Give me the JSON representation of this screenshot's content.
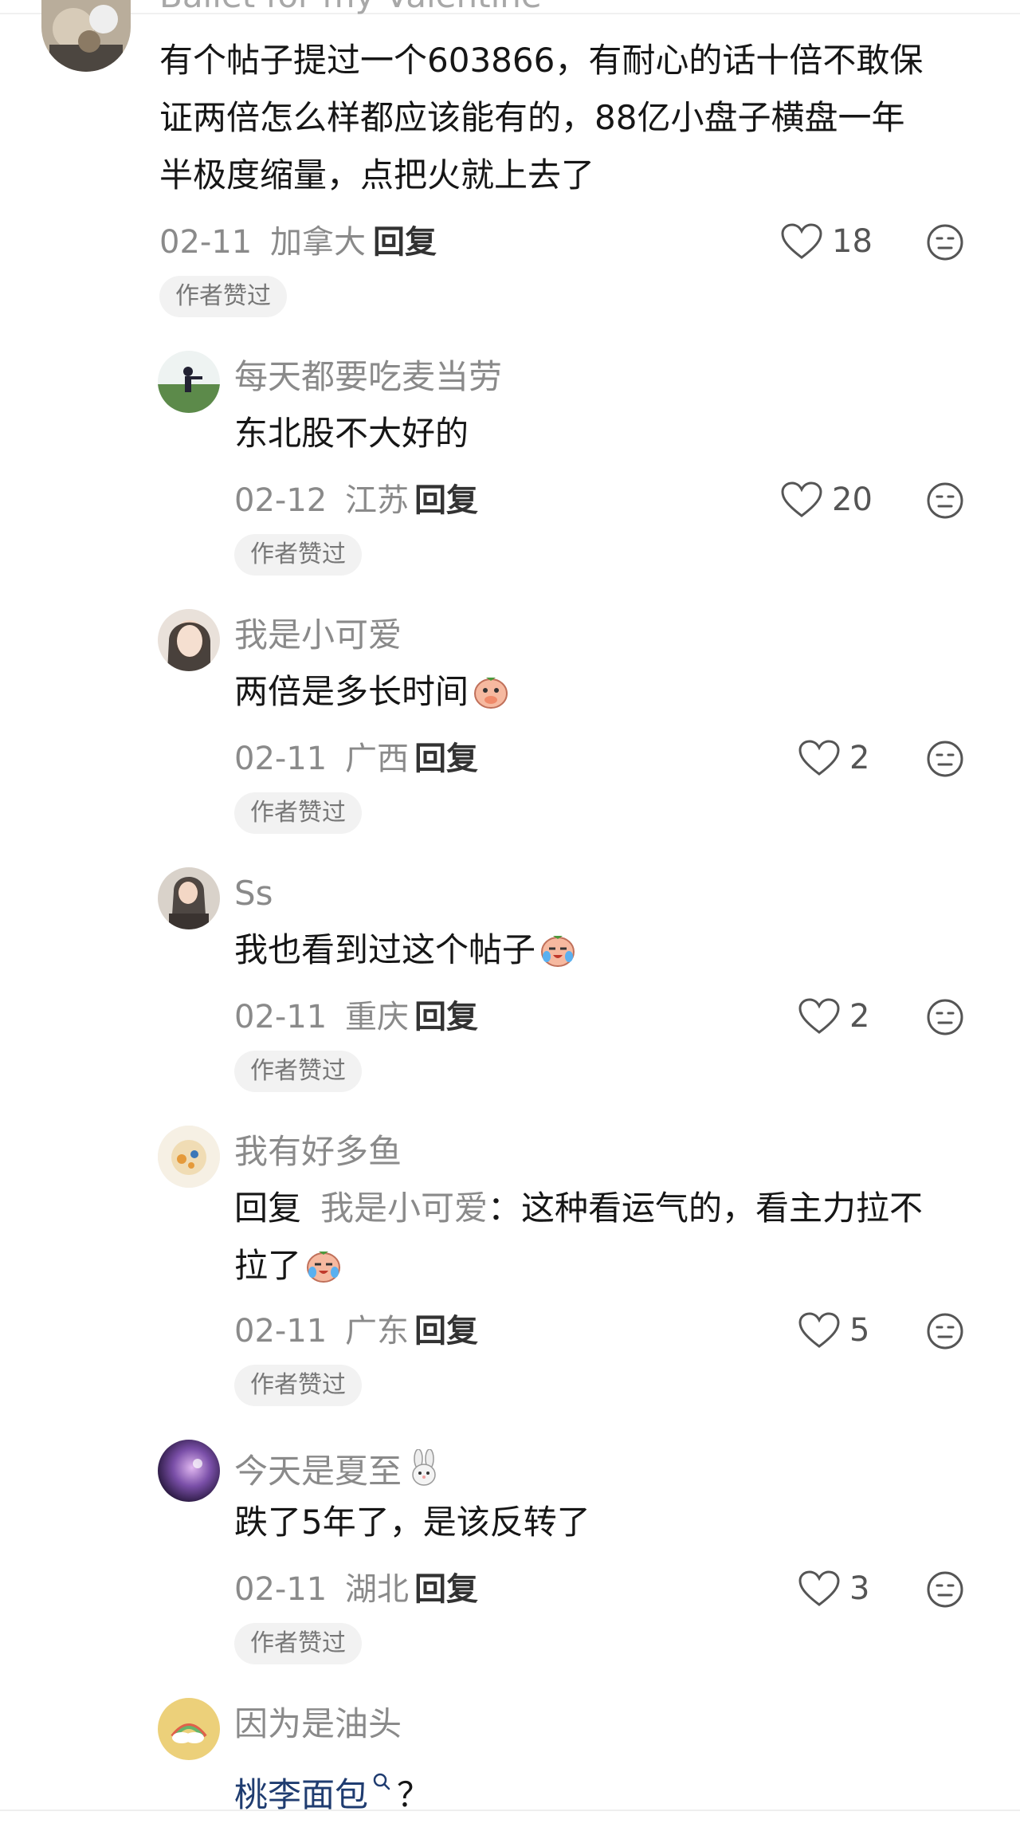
{
  "header_partial_username": "Ballet for my Valentine",
  "comments": [
    {
      "content_lines": [
        "有个帖子提过一个603866，有耐心的话十倍不敢保",
        "证两倍怎么样都应该能有的，88亿小盘子横盘一年",
        "半极度缩量，点把火就上去了"
      ],
      "date": "02-11",
      "location": "加拿大",
      "reply_label": "回复",
      "likes": "18",
      "badge": "作者赞过"
    },
    {
      "username": "每天都要吃麦当劳",
      "content": "东北股不大好的",
      "date": "02-12",
      "location": "江苏",
      "reply_label": "回复",
      "likes": "20",
      "badge": "作者赞过"
    },
    {
      "username": "我是小可爱",
      "content": "两倍是多长时间",
      "emoji": "covering-mouth-emoji",
      "date": "02-11",
      "location": "广西",
      "reply_label": "回复",
      "likes": "2",
      "badge": "作者赞过"
    },
    {
      "username": "Ss",
      "content": "我也看到过这个帖子",
      "emoji": "crying-laughing-emoji",
      "date": "02-11",
      "location": "重庆",
      "reply_label": "回复",
      "likes": "2",
      "badge": "作者赞过"
    },
    {
      "username": "我有好多鱼",
      "reply_prefix": "回复",
      "mention": "我是小可爱",
      "content_line1": "：这种看运气的，看主力拉不",
      "content_line2": "拉了",
      "emoji": "crying-laughing-emoji",
      "date": "02-11",
      "location": "广东",
      "reply_label": "回复",
      "likes": "5",
      "badge": "作者赞过"
    },
    {
      "username": "今天是夏至",
      "username_emoji": "rabbit-emoji",
      "content": "跌了5年了，是该反转了",
      "date": "02-11",
      "location": "湖北",
      "reply_label": "回复",
      "likes": "3",
      "badge": "作者赞过"
    },
    {
      "username": "因为是油头",
      "link_text": "桃李面包",
      "link_suffix": "？"
    }
  ],
  "icons": {
    "like": "heart-outline-icon",
    "dislike": "unamused-face-icon",
    "link": "search-icon"
  },
  "colors": {
    "text": "#161616",
    "muted": "#8a8a8a",
    "link": "#1f3c70",
    "badge_bg": "#f2f2f2"
  }
}
